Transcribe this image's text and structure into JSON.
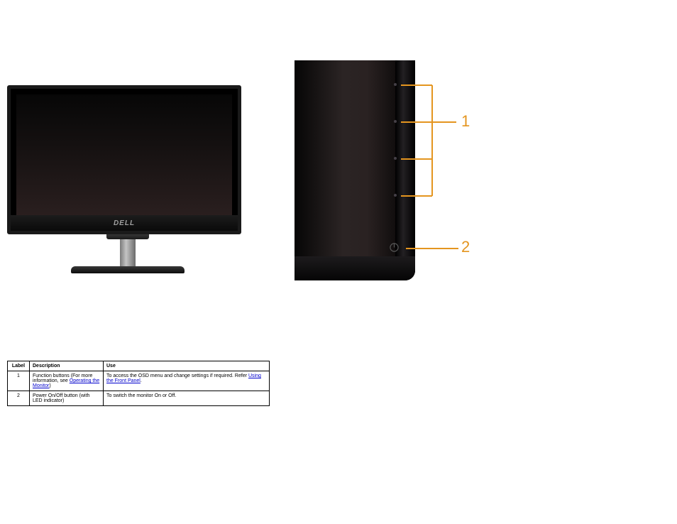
{
  "monitor": {
    "brand_logo_text": "DELL"
  },
  "callouts": {
    "label_1": "1",
    "label_2": "2"
  },
  "table": {
    "headers": {
      "label": "Label",
      "description": "Description",
      "use": "Use"
    },
    "rows": [
      {
        "label": "1",
        "description": "Function buttons (For more information, see ",
        "description_link": "Operating the Monitor",
        "description_after": ")",
        "use": "To access the OSD menu and change settings if required. Refer ",
        "use_link": "Using the Front Panel",
        "use_after": "."
      },
      {
        "label": "2",
        "description": "Power On/Off button (with LED indicator)",
        "use": "To switch the monitor On or Off."
      }
    ]
  }
}
